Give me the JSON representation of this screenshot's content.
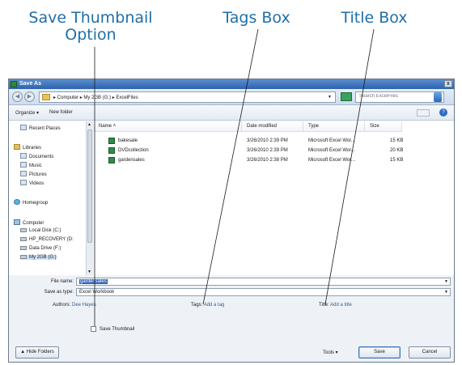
{
  "callouts": {
    "save_thumbnail_line1": "Save Thumbnail",
    "save_thumbnail_line2": "Option",
    "tags_box": "Tags Box",
    "title_box": "Title Box"
  },
  "dialog": {
    "title": "Save As",
    "close_glyph": "x",
    "breadcrumb": "▸ Computer ▸ My 2GB (G:) ▸ ExcelFiles",
    "search_placeholder": "Search ExcelFiles",
    "toolbar": {
      "organize": "Organize ▾",
      "new_folder": "New folder",
      "help": "?"
    },
    "nav_items": [
      "Recent Places",
      "Libraries",
      "Documents",
      "Music",
      "Pictures",
      "Videos",
      "Homegroup",
      "Computer",
      "Local Disk (C:)",
      "HP_RECOVERY (D:",
      "Data Drive (F:)",
      "My 2GB (G:)"
    ],
    "columns": {
      "name": "Name ˄",
      "date": "Date modified",
      "type": "Type",
      "size": "Size"
    },
    "files": [
      {
        "name": "bakesale",
        "date": "3/26/2010 2:39 PM",
        "type": "Microsoft Excel Wor...",
        "size": "15 KB"
      },
      {
        "name": "DVDcollection",
        "date": "3/26/2010 2:39 PM",
        "type": "Microsoft Excel Wor...",
        "size": "20 KB"
      },
      {
        "name": "gardensales",
        "date": "3/26/2010 2:38 PM",
        "type": "Microsoft Excel Wor...",
        "size": "15 KB"
      }
    ],
    "form": {
      "file_name_label": "File name:",
      "file_name_value": "gardensales",
      "save_type_label": "Save as type:",
      "save_type_value": "Excel Workbook",
      "authors_label": "Authors:",
      "authors_value": "Dee Hayes",
      "tags_label": "Tags:",
      "tags_value": "Add a tag",
      "title_label": "Title:",
      "title_value": "Add a title",
      "save_thumbnail": "Save Thumbnail"
    },
    "buttons": {
      "hide_folders": "Hide Folders",
      "tools": "Tools ▾",
      "save": "Save",
      "cancel": "Cancel"
    }
  }
}
